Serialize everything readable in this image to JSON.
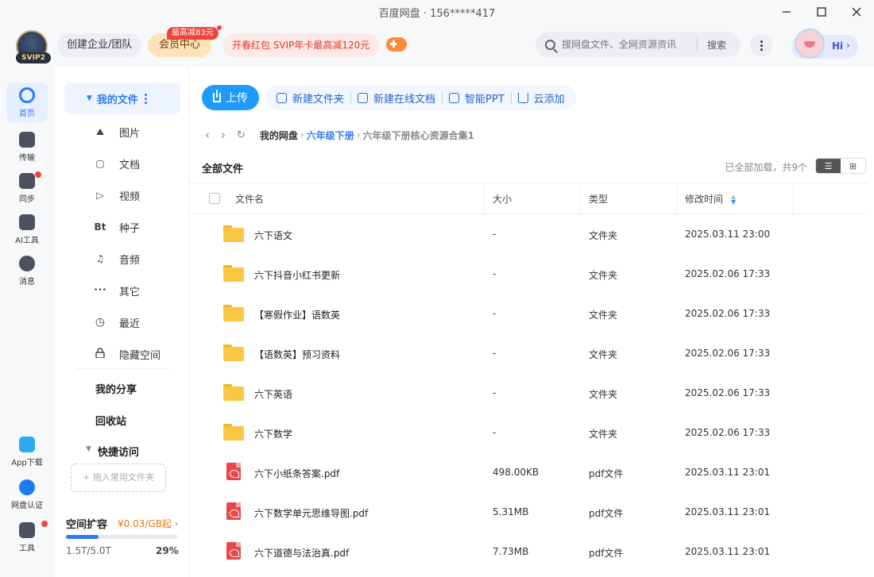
{
  "window": {
    "title": "百度网盘 · 156*****417"
  },
  "header": {
    "svip_label": "SVIP2",
    "team_button": "创建企业/团队",
    "vip_center": "会员中心",
    "vip_badge": "最高减83元",
    "promo": "开春红包 SVIP年卡最高减120元",
    "search_placeholder": "搜网盘文件、全网资源资讯",
    "search_button": "搜索",
    "greeting": "Hi"
  },
  "leftnav": {
    "items": [
      {
        "label": "首页",
        "icon": "cloud-home-icon"
      },
      {
        "label": "传输",
        "icon": "transfer-icon"
      },
      {
        "label": "同步",
        "icon": "sync-icon"
      },
      {
        "label": "AI工具",
        "icon": "ai-tools-icon"
      },
      {
        "label": "消息",
        "icon": "message-icon"
      },
      {
        "label": "App下载",
        "icon": "phone-icon"
      },
      {
        "label": "网盘认证",
        "icon": "verify-icon"
      },
      {
        "label": "工具",
        "icon": "tools-grid-icon"
      }
    ]
  },
  "sidebar": {
    "my_files": "我的文件",
    "categories": [
      {
        "label": "图片",
        "icon": "image-icon",
        "glyph": "⛰"
      },
      {
        "label": "文档",
        "icon": "document-icon",
        "glyph": "▢"
      },
      {
        "label": "视频",
        "icon": "video-icon",
        "glyph": "▷"
      },
      {
        "label": "种子",
        "icon": "torrent-icon",
        "glyph": "Bt"
      },
      {
        "label": "音频",
        "icon": "headphones-icon",
        "glyph": "♫"
      },
      {
        "label": "其它",
        "icon": "more-dots-icon",
        "glyph": "•••"
      },
      {
        "label": "最近",
        "icon": "recent-clock-icon",
        "glyph": "◷"
      },
      {
        "label": "隐藏空间",
        "icon": "lock-icon",
        "glyph": "🔒"
      }
    ],
    "my_share": "我的分享",
    "recycle": "回收站",
    "quick_access": "快捷访问",
    "drop_hint": "+ 拖入常用文件夹",
    "space": {
      "label": "空间扩容",
      "price": "¥0.03/GB起",
      "used": "1.5T/5.0T",
      "percent": "29%",
      "fraction": 0.29
    }
  },
  "toolbar": {
    "upload": "上传",
    "tools": [
      {
        "label": "新建文件夹",
        "icon": "new-folder-icon"
      },
      {
        "label": "新建在线文档",
        "icon": "new-doc-icon"
      },
      {
        "label": "智能PPT",
        "icon": "ppt-icon"
      },
      {
        "label": "云添加",
        "icon": "cloud-add-icon"
      }
    ]
  },
  "breadcrumb": {
    "root": "我的网盘",
    "parent": "六年级下册",
    "current": "六年级下册核心资源合集1"
  },
  "list": {
    "title": "全部文件",
    "status": "已全部加载，共9个",
    "columns": {
      "name": "文件名",
      "size": "大小",
      "type": "类型",
      "modified": "修改时间"
    },
    "rows": [
      {
        "name": "六下语文",
        "size": "-",
        "type": "文件夹",
        "modified": "2025.03.11 23:00",
        "kind": "folder"
      },
      {
        "name": "六下抖音小红书更新",
        "size": "-",
        "type": "文件夹",
        "modified": "2025.02.06 17:33",
        "kind": "folder"
      },
      {
        "name": "【寒假作业】语数英",
        "size": "-",
        "type": "文件夹",
        "modified": "2025.02.06 17:33",
        "kind": "folder"
      },
      {
        "name": "【语数英】预习资料",
        "size": "-",
        "type": "文件夹",
        "modified": "2025.02.06 17:33",
        "kind": "folder"
      },
      {
        "name": "六下英语",
        "size": "-",
        "type": "文件夹",
        "modified": "2025.02.06 17:33",
        "kind": "folder"
      },
      {
        "name": "六下数学",
        "size": "-",
        "type": "文件夹",
        "modified": "2025.02.06 17:33",
        "kind": "folder"
      },
      {
        "name": "六下小纸条答案.pdf",
        "size": "498.00KB",
        "type": "pdf文件",
        "modified": "2025.03.11 23:01",
        "kind": "pdf"
      },
      {
        "name": "六下数学单元思维导图.pdf",
        "size": "5.31MB",
        "type": "pdf文件",
        "modified": "2025.03.11 23:01",
        "kind": "pdf"
      },
      {
        "name": "六下道德与法治真.pdf",
        "size": "7.73MB",
        "type": "pdf文件",
        "modified": "2025.03.11 23:01",
        "kind": "pdf"
      }
    ]
  }
}
